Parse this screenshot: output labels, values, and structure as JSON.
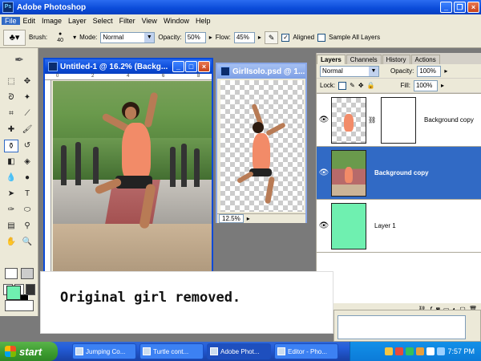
{
  "window": {
    "title": "Adobe Photoshop"
  },
  "menu": {
    "items": [
      "File",
      "Edit",
      "Image",
      "Layer",
      "Select",
      "Filter",
      "View",
      "Window",
      "Help"
    ]
  },
  "options": {
    "brush_label": "Brush:",
    "brush_size": "40",
    "mode_label": "Mode:",
    "mode_value": "Normal",
    "opacity_label": "Opacity:",
    "opacity_value": "50%",
    "flow_label": "Flow:",
    "flow_value": "45%",
    "aligned_label": "Aligned",
    "sample_all_label": "Sample All Layers"
  },
  "doc_main": {
    "title": "Untitled-1 @ 16.2% (Backg...",
    "ruler_marks": [
      "0",
      "2",
      "4",
      "6",
      "8"
    ]
  },
  "doc_second": {
    "title": "GirlIsolo.psd @ 1...",
    "zoom": "12.5%"
  },
  "layers_panel": {
    "tabs": [
      "Layers",
      "Channels",
      "History",
      "Actions"
    ],
    "blend_mode": "Normal",
    "opacity_label": "Opacity:",
    "opacity_value": "100%",
    "lock_label": "Lock:",
    "fill_label": "Fill:",
    "fill_value": "100%",
    "layers": [
      {
        "name": "Background copy",
        "selected": false
      },
      {
        "name": "Background copy",
        "selected": true
      },
      {
        "name": "Layer 1",
        "selected": false
      }
    ]
  },
  "colors": {
    "foreground": "#6ff0b0",
    "background": "#000000",
    "layer1_fill": "#6ff0b0",
    "accent": "#316ac5"
  },
  "caption": {
    "text": "Original girl removed."
  },
  "taskbar": {
    "start_label": "start",
    "tasks": [
      "Jumping Co...",
      "Turtle cont...",
      "Adobe Phot...",
      "Editor - Pho..."
    ],
    "clock": "7:57 PM"
  }
}
